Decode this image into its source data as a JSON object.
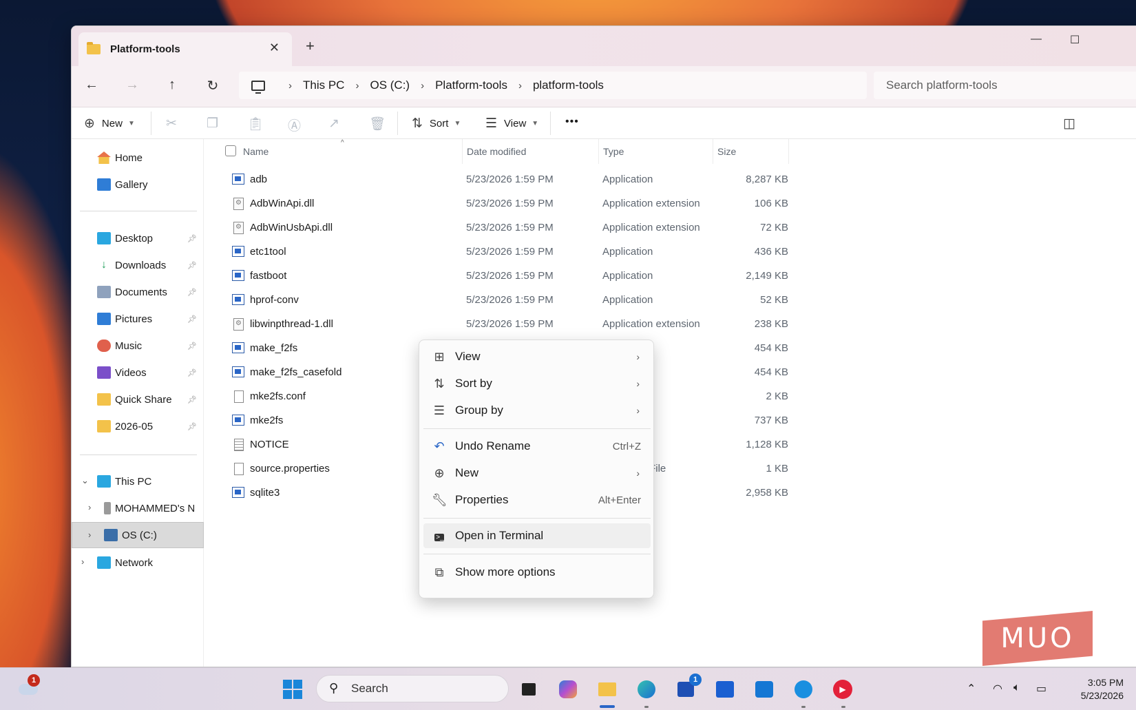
{
  "window": {
    "tab_title": "Platform-tools",
    "tab_close": "✕",
    "new_tab": "+",
    "minimize": "—",
    "maximize": "☐"
  },
  "nav": {
    "back": "←",
    "forward": "→",
    "up": "↑",
    "refresh": "↻"
  },
  "breadcrumb": [
    "This PC",
    "OS (C:)",
    "Platform-tools",
    "platform-tools"
  ],
  "breadcrumb_sep": "›",
  "search": {
    "placeholder": "Search platform-tools"
  },
  "toolbar": {
    "new_label": "New",
    "sort_label": "Sort",
    "view_label": "View",
    "more": "•••"
  },
  "sidebar": {
    "home": "Home",
    "gallery": "Gallery",
    "quick_access": [
      {
        "label": "Desktop"
      },
      {
        "label": "Downloads"
      },
      {
        "label": "Documents"
      },
      {
        "label": "Pictures"
      },
      {
        "label": "Music"
      },
      {
        "label": "Videos"
      },
      {
        "label": "Quick Share"
      },
      {
        "label": "2026-05"
      }
    ],
    "this_pc": "This PC",
    "phone": "MOHAMMED's N",
    "os_drive": "OS (C:)",
    "network": "Network"
  },
  "columns": {
    "name": "Name",
    "date": "Date modified",
    "type": "Type",
    "size": "Size"
  },
  "files": [
    {
      "name": "adb",
      "date": "5/23/2026 1:59 PM",
      "type": "Application",
      "size": "8,287 KB",
      "icon": "app"
    },
    {
      "name": "AdbWinApi.dll",
      "date": "5/23/2026 1:59 PM",
      "type": "Application extension",
      "size": "106 KB",
      "icon": "dll"
    },
    {
      "name": "AdbWinUsbApi.dll",
      "date": "5/23/2026 1:59 PM",
      "type": "Application extension",
      "size": "72 KB",
      "icon": "dll"
    },
    {
      "name": "etc1tool",
      "date": "5/23/2026 1:59 PM",
      "type": "Application",
      "size": "436 KB",
      "icon": "app"
    },
    {
      "name": "fastboot",
      "date": "5/23/2026 1:59 PM",
      "type": "Application",
      "size": "2,149 KB",
      "icon": "app"
    },
    {
      "name": "hprof-conv",
      "date": "5/23/2026 1:59 PM",
      "type": "Application",
      "size": "52 KB",
      "icon": "app"
    },
    {
      "name": "libwinpthread-1.dll",
      "date": "5/23/2026 1:59 PM",
      "type": "Application extension",
      "size": "238 KB",
      "icon": "dll"
    },
    {
      "name": "make_f2fs",
      "date": "",
      "type": "lication",
      "size": "454 KB",
      "icon": "app"
    },
    {
      "name": "make_f2fs_casefold",
      "date": "",
      "type": "lication",
      "size": "454 KB",
      "icon": "app"
    },
    {
      "name": "mke2fs.conf",
      "date": "",
      "type": "IF File",
      "size": "2 KB",
      "icon": "file"
    },
    {
      "name": "mke2fs",
      "date": "",
      "type": "lication",
      "size": "737 KB",
      "icon": "app"
    },
    {
      "name": "NOTICE",
      "date": "",
      "type": "Document",
      "size": "1,128 KB",
      "icon": "text"
    },
    {
      "name": "source.properties",
      "date": "",
      "type": "PERTIES File",
      "size": "1 KB",
      "icon": "file"
    },
    {
      "name": "sqlite3",
      "date": "",
      "type": "lication",
      "size": "2,958 KB",
      "icon": "app"
    }
  ],
  "context_menu": {
    "view": "View",
    "sort_by": "Sort by",
    "group_by": "Group by",
    "undo_rename": "Undo Rename",
    "undo_shortcut": "Ctrl+Z",
    "new": "New",
    "properties": "Properties",
    "properties_shortcut": "Alt+Enter",
    "open_terminal": "Open in Terminal",
    "show_more": "Show more options"
  },
  "watermark": "MUO",
  "taskbar": {
    "search_label": "Search",
    "weather_badge": "1",
    "store_badge": "1",
    "time": "3:05 PM",
    "date": "5/23/2026"
  }
}
